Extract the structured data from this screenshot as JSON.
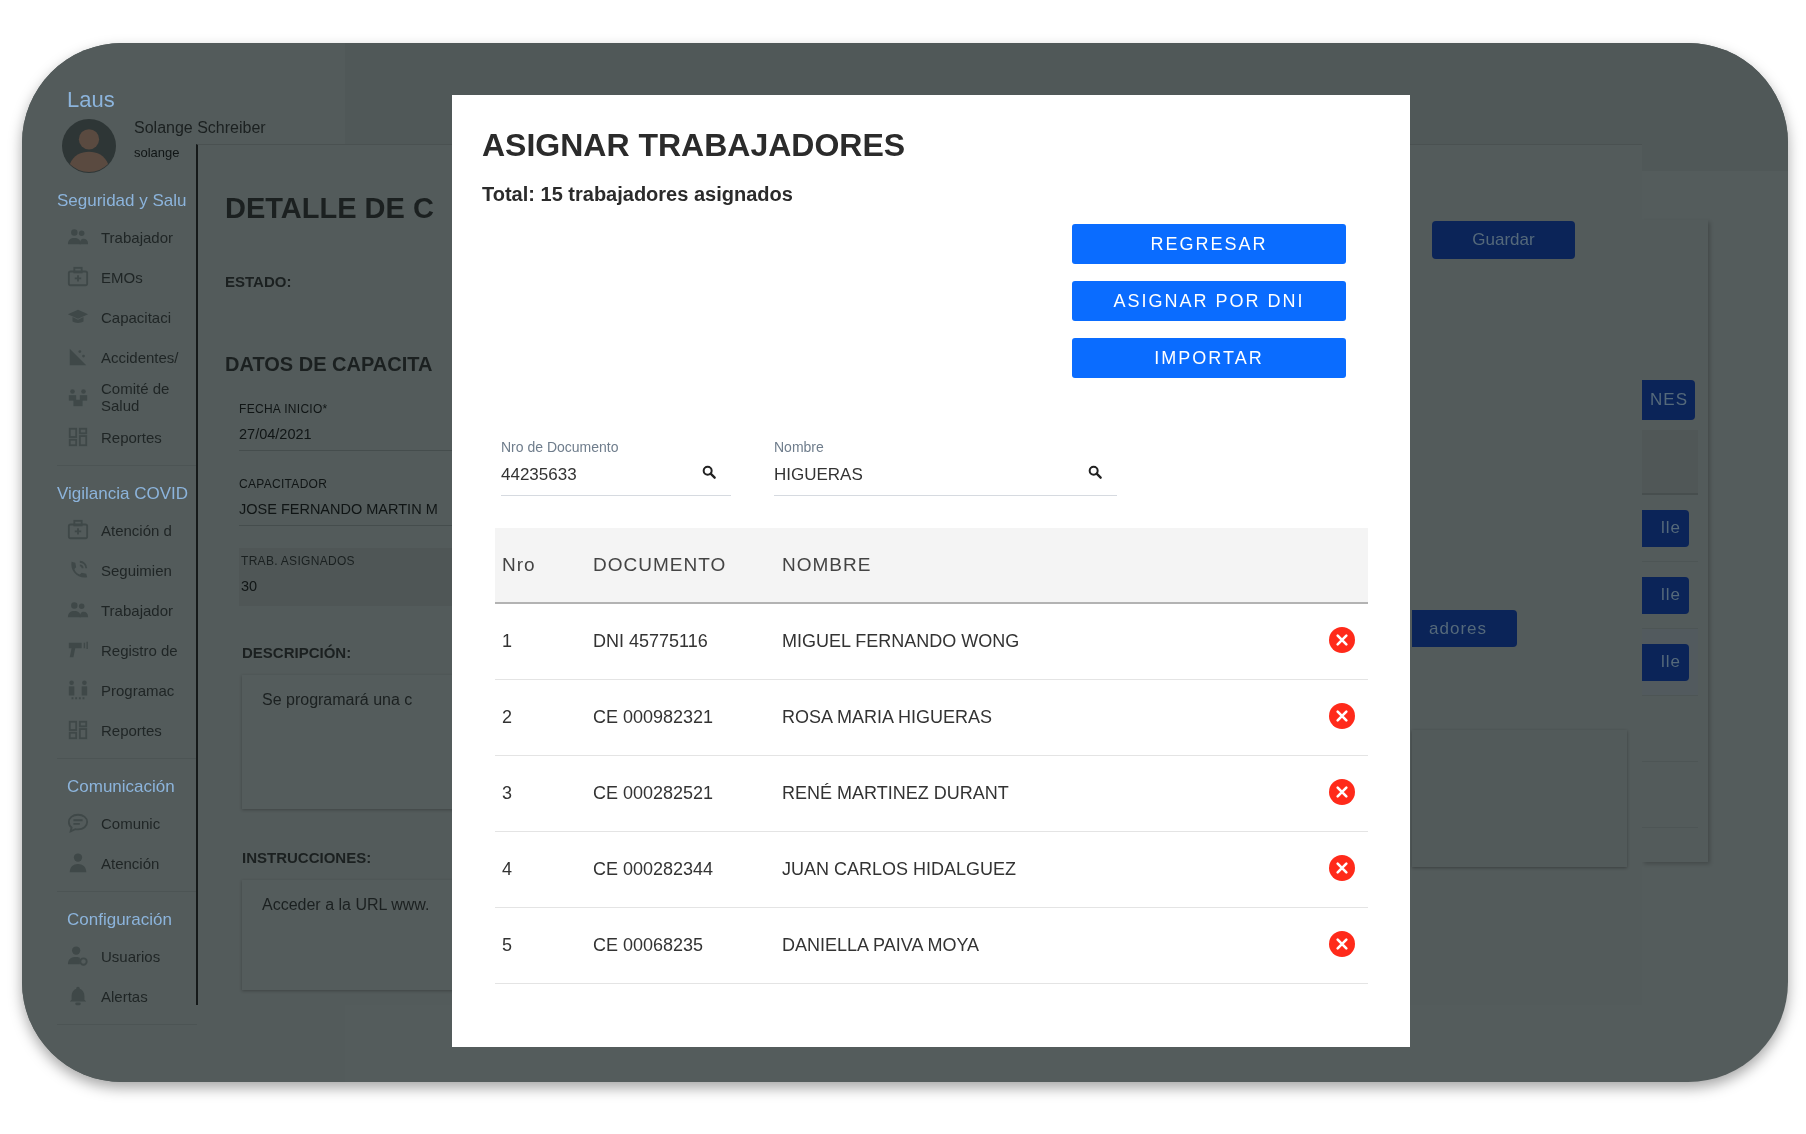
{
  "sidebar": {
    "brand": "Laus",
    "user": {
      "name": "Solange Schreiber",
      "handle": "solange"
    },
    "sections": [
      {
        "title": "Seguridad y Salu",
        "items": [
          {
            "label": "Trabajador"
          },
          {
            "label": "EMOs"
          },
          {
            "label": "Capacitaci"
          },
          {
            "label": "Accidentes/"
          },
          {
            "label": "Comité de Salud"
          },
          {
            "label": "Reportes"
          }
        ]
      },
      {
        "title": "Vigilancia COVID",
        "items": [
          {
            "label": "Atención d"
          },
          {
            "label": "Seguimien"
          },
          {
            "label": "Trabajador"
          },
          {
            "label": "Registro de"
          },
          {
            "label": "Programac"
          },
          {
            "label": "Reportes"
          }
        ]
      },
      {
        "title": "Comunicación",
        "items": [
          {
            "label": "Comunic"
          },
          {
            "label": "Atención"
          }
        ]
      },
      {
        "title": "Configuración",
        "items": [
          {
            "label": "Usuarios"
          },
          {
            "label": "Alertas"
          }
        ]
      }
    ]
  },
  "detail": {
    "title": "DETALLE DE C",
    "status_label": "ESTADO:",
    "section_title": "DATOS DE CAPACITA",
    "fields": [
      {
        "label": "FECHA INICIO*",
        "value": "27/04/2021",
        "disabled": false
      },
      {
        "label": "CAPACITADOR",
        "value": "JOSE FERNANDO MARTIN M",
        "disabled": false
      },
      {
        "label": "TRAB. ASIGNADOS",
        "value": "30",
        "disabled": true
      }
    ],
    "description": {
      "label": "DESCRIPCIÓN:",
      "text": "Se programará una c"
    },
    "instructions": {
      "label": "INSTRUCCIONES:",
      "text": "Acceder a la URL www."
    },
    "save_button": "Guardar",
    "workers_button": "adores"
  },
  "side_card": {
    "top_button": "NES",
    "row_buttons": [
      "lle",
      "lle",
      "lle"
    ]
  },
  "modal": {
    "title": "ASIGNAR TRABAJADORES",
    "total": "Total: 15 trabajadores asignados",
    "buttons": [
      "REGRESAR",
      "ASIGNAR POR DNI",
      "IMPORTAR"
    ],
    "filters": [
      {
        "label": "Nro de Documento",
        "value": "44235633"
      },
      {
        "label": "Nombre",
        "value": "HIGUERAS"
      }
    ],
    "table": {
      "columns": [
        "Nro",
        "DOCUMENTO",
        "NOMBRE"
      ],
      "rows": [
        {
          "nro": "1",
          "documento": "DNI 45775116",
          "nombre": "MIGUEL FERNANDO WONG"
        },
        {
          "nro": "2",
          "documento": "CE 000982321",
          "nombre": "ROSA MARIA HIGUERAS"
        },
        {
          "nro": "3",
          "documento": "CE 000282521",
          "nombre": "RENÉ MARTINEZ DURANT"
        },
        {
          "nro": "4",
          "documento": "CE 000282344",
          "nombre": "JUAN CARLOS HIDALGUEZ"
        },
        {
          "nro": "5",
          "documento": "CE 00068235",
          "nombre": "DANIELLA PAIVA MOYA"
        }
      ]
    }
  }
}
